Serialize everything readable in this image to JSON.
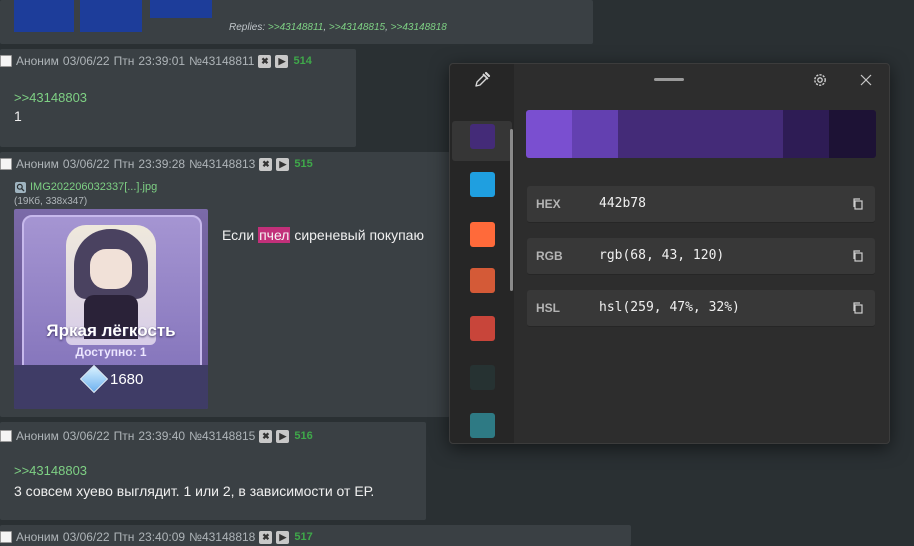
{
  "top_post": {
    "replies_label": "Replies:",
    "replies": [
      ">>43148811",
      ">>43148815",
      ">>43148818"
    ]
  },
  "posts": [
    {
      "author": "Аноним",
      "date": "03/06/22",
      "weekday": "Птн",
      "time": "23:39:01",
      "id": "№43148811",
      "number": "514",
      "reply_to": ">>43148803",
      "text": "1"
    },
    {
      "author": "Аноним",
      "date": "03/06/22",
      "weekday": "Птн",
      "time": "23:39:28",
      "id": "№43148813",
      "number": "515",
      "file_name": "IMG202206032337[...].jpg",
      "file_info": "(19Кб, 338x347)",
      "text_before": "Если ",
      "text_mark": "пчел",
      "text_after": " сиреневый покупаю",
      "image": {
        "title": "Яркая лёгкость",
        "subtitle": "Доступно: 1",
        "price": "1680"
      }
    },
    {
      "author": "Аноним",
      "date": "03/06/22",
      "weekday": "Птн",
      "time": "23:39:40",
      "id": "№43148815",
      "number": "516",
      "reply_to": ">>43148803",
      "text": "3 совсем хуево выглядит. 1 или 2, в зависимости от ЕР."
    },
    {
      "author": "Аноним",
      "date": "03/06/22",
      "weekday": "Птн",
      "time": "23:40:09",
      "id": "№43148818",
      "number": "517"
    }
  ],
  "color_picker": {
    "swatches": [
      "#442b78",
      "#1f9fe0",
      "#ff6a3a",
      "#d45a37",
      "#c8453a",
      "#263232",
      "#2e7a84"
    ],
    "gradient": [
      "#7a4fd0",
      "#6340b0",
      "#442b78",
      "#442b78",
      "#2e1c55",
      "#1d1235"
    ],
    "values": [
      {
        "label": "HEX",
        "value": "442b78"
      },
      {
        "label": "RGB",
        "value": "rgb(68, 43, 120)"
      },
      {
        "label": "HSL",
        "value": "hsl(259, 47%, 32%)"
      }
    ]
  }
}
